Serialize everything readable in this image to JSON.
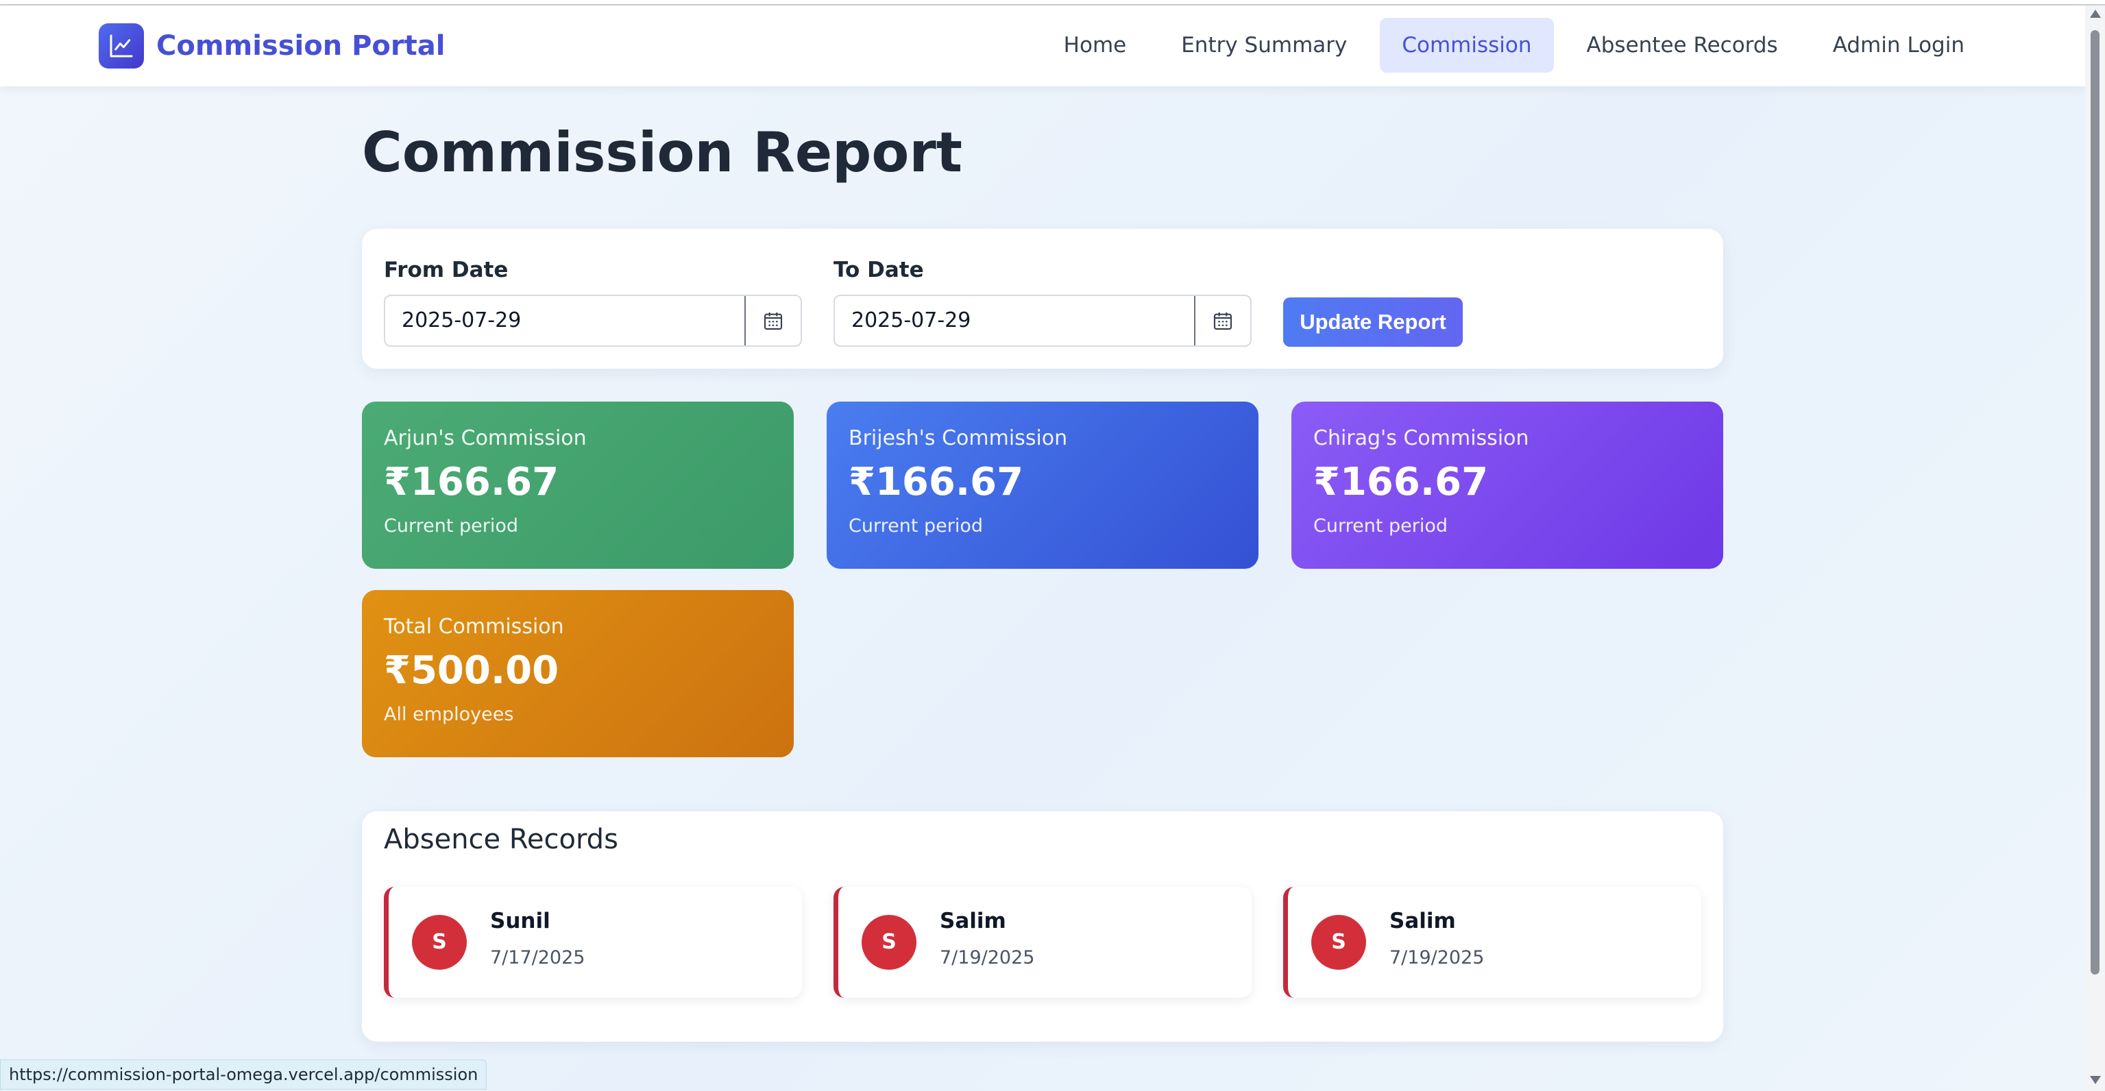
{
  "brand": {
    "title": "Commission Portal",
    "icon": "chart-line-icon"
  },
  "nav": {
    "items": [
      {
        "label": "Home",
        "active": false
      },
      {
        "label": "Entry Summary",
        "active": false
      },
      {
        "label": "Commission",
        "active": true
      },
      {
        "label": "Absentee Records",
        "active": false
      },
      {
        "label": "Admin Login",
        "active": false
      }
    ]
  },
  "page": {
    "title": "Commission Report"
  },
  "filters": {
    "from_label": "From Date",
    "from_value": "2025-07-29",
    "to_label": "To Date",
    "to_value": "2025-07-29",
    "update_label": "Update Report"
  },
  "cards": [
    {
      "label": "Arjun's Commission",
      "amount": "₹166.67",
      "sub": "Current period",
      "color": "#47a56f"
    },
    {
      "label": "Brijesh's Commission",
      "amount": "₹166.67",
      "sub": "Current period",
      "color": "#3f66e2"
    },
    {
      "label": "Chirag's Commission",
      "amount": "₹166.67",
      "sub": "Current period",
      "color": "#7c4aee"
    },
    {
      "label": "Total Commission",
      "amount": "₹500.00",
      "sub": "All employees",
      "color": "#d88211"
    }
  ],
  "absence": {
    "title": "Absence Records",
    "records": [
      {
        "initial": "S",
        "name": "Sunil",
        "date": "7/17/2025"
      },
      {
        "initial": "S",
        "name": "Salim",
        "date": "7/19/2025"
      },
      {
        "initial": "S",
        "name": "Salim",
        "date": "7/19/2025"
      }
    ]
  },
  "status_bar": {
    "url": "https://commission-portal-omega.vercel.app/commission"
  },
  "colors": {
    "accent": "#4650d6",
    "absence_red": "#d32f3a"
  }
}
